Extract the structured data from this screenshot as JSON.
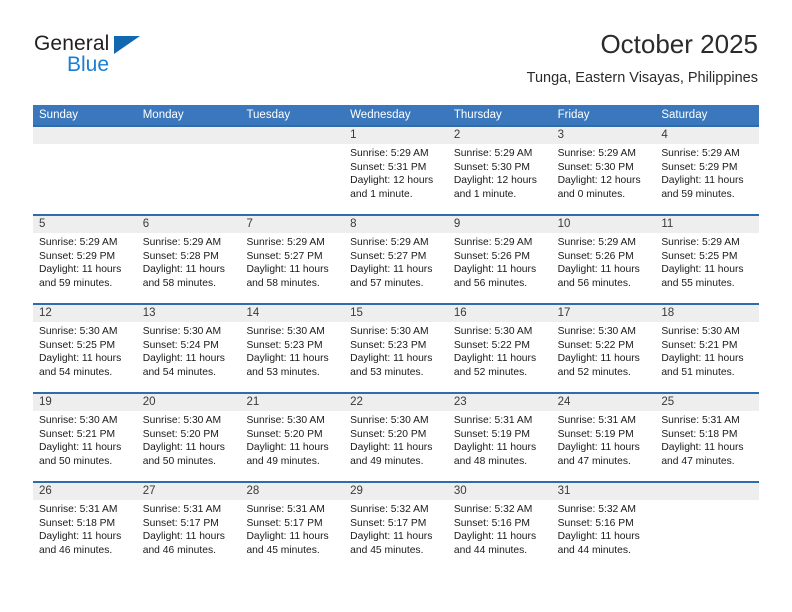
{
  "brand": {
    "name_part1": "General",
    "name_part2": "Blue",
    "flag_icon": "triangle-flag-icon"
  },
  "header": {
    "month_title": "October 2025",
    "location": "Tunga, Eastern Visayas, Philippines"
  },
  "calendar": {
    "accent_color": "#3b77bc",
    "weekday_headers": [
      "Sunday",
      "Monday",
      "Tuesday",
      "Wednesday",
      "Thursday",
      "Friday",
      "Saturday"
    ],
    "weeks": [
      [
        {
          "day": "",
          "sunrise": "",
          "sunset": "",
          "daylight_line1": "",
          "daylight_line2": ""
        },
        {
          "day": "",
          "sunrise": "",
          "sunset": "",
          "daylight_line1": "",
          "daylight_line2": ""
        },
        {
          "day": "",
          "sunrise": "",
          "sunset": "",
          "daylight_line1": "",
          "daylight_line2": ""
        },
        {
          "day": "1",
          "sunrise": "Sunrise: 5:29 AM",
          "sunset": "Sunset: 5:31 PM",
          "daylight_line1": "Daylight: 12 hours",
          "daylight_line2": "and 1 minute."
        },
        {
          "day": "2",
          "sunrise": "Sunrise: 5:29 AM",
          "sunset": "Sunset: 5:30 PM",
          "daylight_line1": "Daylight: 12 hours",
          "daylight_line2": "and 1 minute."
        },
        {
          "day": "3",
          "sunrise": "Sunrise: 5:29 AM",
          "sunset": "Sunset: 5:30 PM",
          "daylight_line1": "Daylight: 12 hours",
          "daylight_line2": "and 0 minutes."
        },
        {
          "day": "4",
          "sunrise": "Sunrise: 5:29 AM",
          "sunset": "Sunset: 5:29 PM",
          "daylight_line1": "Daylight: 11 hours",
          "daylight_line2": "and 59 minutes."
        }
      ],
      [
        {
          "day": "5",
          "sunrise": "Sunrise: 5:29 AM",
          "sunset": "Sunset: 5:29 PM",
          "daylight_line1": "Daylight: 11 hours",
          "daylight_line2": "and 59 minutes."
        },
        {
          "day": "6",
          "sunrise": "Sunrise: 5:29 AM",
          "sunset": "Sunset: 5:28 PM",
          "daylight_line1": "Daylight: 11 hours",
          "daylight_line2": "and 58 minutes."
        },
        {
          "day": "7",
          "sunrise": "Sunrise: 5:29 AM",
          "sunset": "Sunset: 5:27 PM",
          "daylight_line1": "Daylight: 11 hours",
          "daylight_line2": "and 58 minutes."
        },
        {
          "day": "8",
          "sunrise": "Sunrise: 5:29 AM",
          "sunset": "Sunset: 5:27 PM",
          "daylight_line1": "Daylight: 11 hours",
          "daylight_line2": "and 57 minutes."
        },
        {
          "day": "9",
          "sunrise": "Sunrise: 5:29 AM",
          "sunset": "Sunset: 5:26 PM",
          "daylight_line1": "Daylight: 11 hours",
          "daylight_line2": "and 56 minutes."
        },
        {
          "day": "10",
          "sunrise": "Sunrise: 5:29 AM",
          "sunset": "Sunset: 5:26 PM",
          "daylight_line1": "Daylight: 11 hours",
          "daylight_line2": "and 56 minutes."
        },
        {
          "day": "11",
          "sunrise": "Sunrise: 5:29 AM",
          "sunset": "Sunset: 5:25 PM",
          "daylight_line1": "Daylight: 11 hours",
          "daylight_line2": "and 55 minutes."
        }
      ],
      [
        {
          "day": "12",
          "sunrise": "Sunrise: 5:30 AM",
          "sunset": "Sunset: 5:25 PM",
          "daylight_line1": "Daylight: 11 hours",
          "daylight_line2": "and 54 minutes."
        },
        {
          "day": "13",
          "sunrise": "Sunrise: 5:30 AM",
          "sunset": "Sunset: 5:24 PM",
          "daylight_line1": "Daylight: 11 hours",
          "daylight_line2": "and 54 minutes."
        },
        {
          "day": "14",
          "sunrise": "Sunrise: 5:30 AM",
          "sunset": "Sunset: 5:23 PM",
          "daylight_line1": "Daylight: 11 hours",
          "daylight_line2": "and 53 minutes."
        },
        {
          "day": "15",
          "sunrise": "Sunrise: 5:30 AM",
          "sunset": "Sunset: 5:23 PM",
          "daylight_line1": "Daylight: 11 hours",
          "daylight_line2": "and 53 minutes."
        },
        {
          "day": "16",
          "sunrise": "Sunrise: 5:30 AM",
          "sunset": "Sunset: 5:22 PM",
          "daylight_line1": "Daylight: 11 hours",
          "daylight_line2": "and 52 minutes."
        },
        {
          "day": "17",
          "sunrise": "Sunrise: 5:30 AM",
          "sunset": "Sunset: 5:22 PM",
          "daylight_line1": "Daylight: 11 hours",
          "daylight_line2": "and 52 minutes."
        },
        {
          "day": "18",
          "sunrise": "Sunrise: 5:30 AM",
          "sunset": "Sunset: 5:21 PM",
          "daylight_line1": "Daylight: 11 hours",
          "daylight_line2": "and 51 minutes."
        }
      ],
      [
        {
          "day": "19",
          "sunrise": "Sunrise: 5:30 AM",
          "sunset": "Sunset: 5:21 PM",
          "daylight_line1": "Daylight: 11 hours",
          "daylight_line2": "and 50 minutes."
        },
        {
          "day": "20",
          "sunrise": "Sunrise: 5:30 AM",
          "sunset": "Sunset: 5:20 PM",
          "daylight_line1": "Daylight: 11 hours",
          "daylight_line2": "and 50 minutes."
        },
        {
          "day": "21",
          "sunrise": "Sunrise: 5:30 AM",
          "sunset": "Sunset: 5:20 PM",
          "daylight_line1": "Daylight: 11 hours",
          "daylight_line2": "and 49 minutes."
        },
        {
          "day": "22",
          "sunrise": "Sunrise: 5:30 AM",
          "sunset": "Sunset: 5:20 PM",
          "daylight_line1": "Daylight: 11 hours",
          "daylight_line2": "and 49 minutes."
        },
        {
          "day": "23",
          "sunrise": "Sunrise: 5:31 AM",
          "sunset": "Sunset: 5:19 PM",
          "daylight_line1": "Daylight: 11 hours",
          "daylight_line2": "and 48 minutes."
        },
        {
          "day": "24",
          "sunrise": "Sunrise: 5:31 AM",
          "sunset": "Sunset: 5:19 PM",
          "daylight_line1": "Daylight: 11 hours",
          "daylight_line2": "and 47 minutes."
        },
        {
          "day": "25",
          "sunrise": "Sunrise: 5:31 AM",
          "sunset": "Sunset: 5:18 PM",
          "daylight_line1": "Daylight: 11 hours",
          "daylight_line2": "and 47 minutes."
        }
      ],
      [
        {
          "day": "26",
          "sunrise": "Sunrise: 5:31 AM",
          "sunset": "Sunset: 5:18 PM",
          "daylight_line1": "Daylight: 11 hours",
          "daylight_line2": "and 46 minutes."
        },
        {
          "day": "27",
          "sunrise": "Sunrise: 5:31 AM",
          "sunset": "Sunset: 5:17 PM",
          "daylight_line1": "Daylight: 11 hours",
          "daylight_line2": "and 46 minutes."
        },
        {
          "day": "28",
          "sunrise": "Sunrise: 5:31 AM",
          "sunset": "Sunset: 5:17 PM",
          "daylight_line1": "Daylight: 11 hours",
          "daylight_line2": "and 45 minutes."
        },
        {
          "day": "29",
          "sunrise": "Sunrise: 5:32 AM",
          "sunset": "Sunset: 5:17 PM",
          "daylight_line1": "Daylight: 11 hours",
          "daylight_line2": "and 45 minutes."
        },
        {
          "day": "30",
          "sunrise": "Sunrise: 5:32 AM",
          "sunset": "Sunset: 5:16 PM",
          "daylight_line1": "Daylight: 11 hours",
          "daylight_line2": "and 44 minutes."
        },
        {
          "day": "31",
          "sunrise": "Sunrise: 5:32 AM",
          "sunset": "Sunset: 5:16 PM",
          "daylight_line1": "Daylight: 11 hours",
          "daylight_line2": "and 44 minutes."
        },
        {
          "day": "",
          "sunrise": "",
          "sunset": "",
          "daylight_line1": "",
          "daylight_line2": ""
        }
      ]
    ]
  }
}
